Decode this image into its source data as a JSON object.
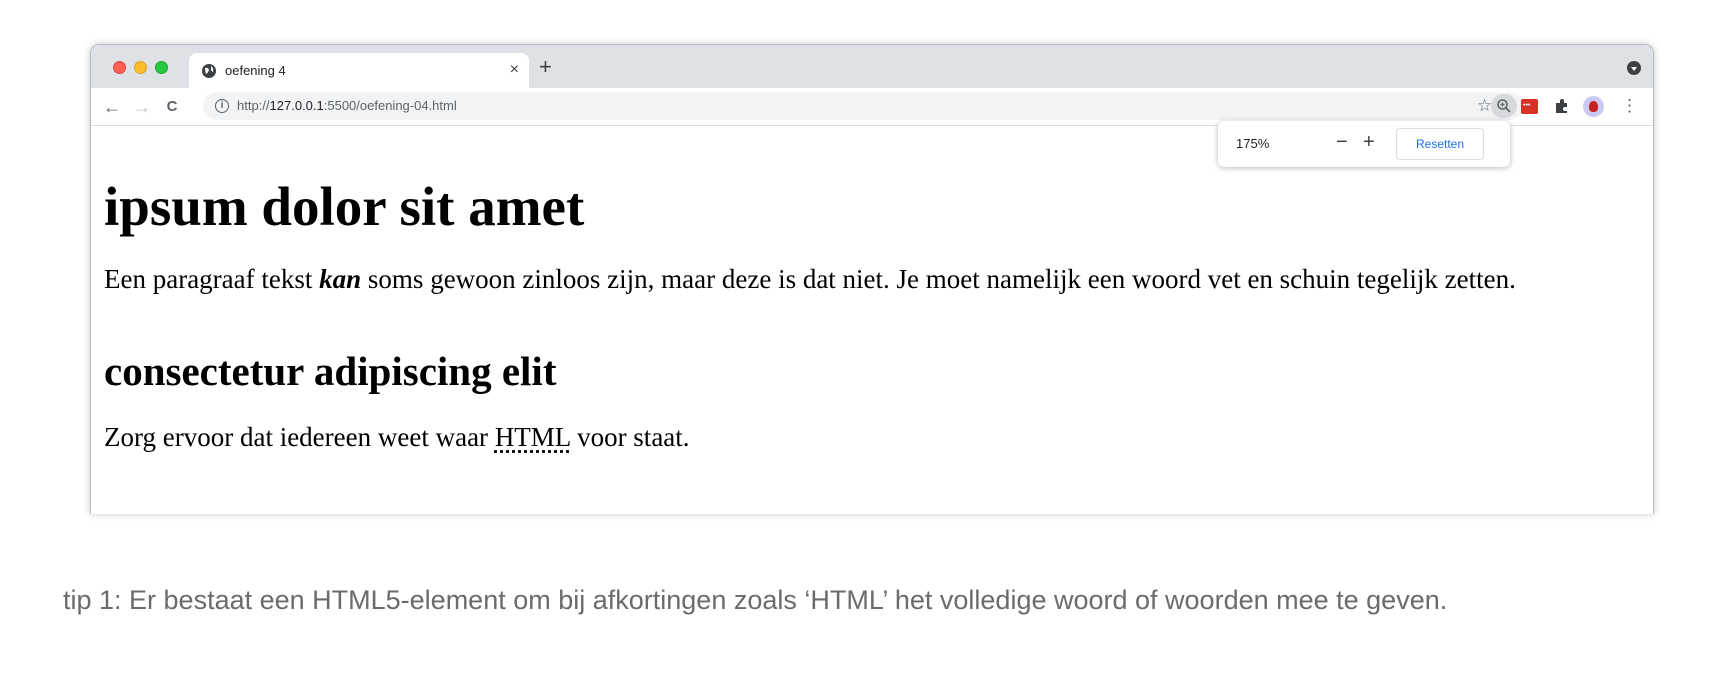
{
  "browser": {
    "tab": {
      "title": "oefening 4",
      "close": "×"
    },
    "new_tab": "+",
    "nav": {
      "back": "←",
      "forward": "→",
      "reload": "C"
    },
    "url": {
      "prefix": "http://",
      "host": "127.0.0.1",
      "rest": ":5500/oefening-04.html"
    },
    "toolbar_icons": [
      "zoom-icon",
      "star-icon",
      "extension-red-icon",
      "puzzle-icon",
      "profile-avatar",
      "menu-icon"
    ],
    "more": "⋮"
  },
  "zoom_popup": {
    "level": "175%",
    "minus": "−",
    "plus": "+",
    "reset_label": "Resetten"
  },
  "page": {
    "heading1": "ipsum dolor sit amet",
    "paragraph1": {
      "before": "Een paragraaf tekst ",
      "emphasis": "kan",
      "after": " soms gewoon zinloos zijn, maar deze is dat niet. Je moet namelijk een woord vet en schuin tegelijk zetten."
    },
    "heading2": "consectetur adipiscing elit",
    "paragraph2": {
      "before": "Zorg ervoor dat iedereen weet waar ",
      "abbr": "HTML",
      "after": " voor staat."
    }
  },
  "tip": "tip 1: Er bestaat een HTML5-element om bij afkortingen zoals ‘HTML’ het volledige woord of woorden mee te geven.",
  "colors": {
    "tabstrip": "#dee1e6",
    "accent_blue": "#1a73e8",
    "tip_text": "#6b6b6b"
  }
}
